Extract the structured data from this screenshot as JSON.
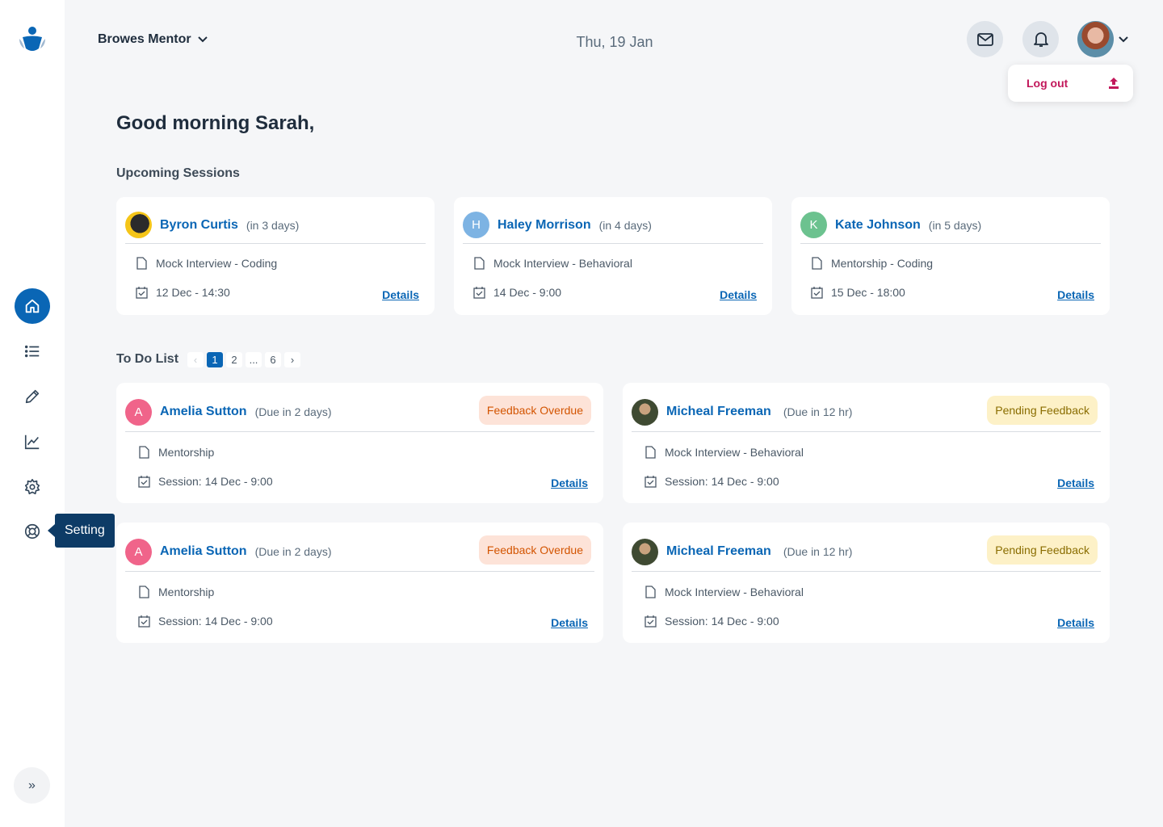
{
  "header": {
    "mentor_select": "Browes Mentor",
    "date": "Thu, 19 Jan"
  },
  "user_menu": {
    "logout_label": "Log out"
  },
  "sidebar": {
    "tooltip": "Setting"
  },
  "greeting": "Good morning Sarah,",
  "upcoming": {
    "title": "Upcoming Sessions",
    "sessions": [
      {
        "initial": "",
        "name": "Byron Curtis",
        "when": "(in 3 days)",
        "type": "Mock Interview - Coding",
        "datetime": "12 Dec - 14:30",
        "details": "Details"
      },
      {
        "initial": "H",
        "name": "Haley Morrison",
        "when": "(in 4 days)",
        "type": "Mock Interview - Behavioral",
        "datetime": "14 Dec - 9:00",
        "details": "Details"
      },
      {
        "initial": "K",
        "name": "Kate Johnson",
        "when": "(in 5 days)",
        "type": "Mentorship - Coding",
        "datetime": "15 Dec - 18:00",
        "details": "Details"
      }
    ]
  },
  "todo": {
    "title": "To Do List",
    "pager": [
      "1",
      "2",
      "...",
      "6"
    ],
    "items": [
      {
        "initial": "A",
        "name": "Amelia Sutton",
        "due": "(Due in 2 days)",
        "badge": "Feedback Overdue",
        "type": "Mentorship",
        "session": "Session: 14 Dec - 9:00",
        "details": "Details"
      },
      {
        "initial": "",
        "name": "Micheal Freeman",
        "due": "(Due in 12 hr)",
        "badge": "Pending Feedback",
        "type": "Mock Interview - Behavioral",
        "session": "Session: 14 Dec - 9:00",
        "details": "Details"
      },
      {
        "initial": "A",
        "name": "Amelia Sutton",
        "due": "(Due in 2 days)",
        "badge": "Feedback Overdue",
        "type": "Mentorship",
        "session": "Session: 14 Dec - 9:00",
        "details": "Details"
      },
      {
        "initial": "",
        "name": "Micheal Freeman",
        "due": "(Due in 12 hr)",
        "badge": "Pending Feedback",
        "type": "Mock Interview - Behavioral",
        "session": "Session: 14 Dec - 9:00",
        "details": "Details"
      }
    ]
  },
  "colors": {
    "primary": "#0a66b5",
    "sidebar_tooltip": "#0d3b66",
    "logout": "#c2185b",
    "overdue_bg": "#fde3d8",
    "pending_bg": "#fdf1c7"
  }
}
